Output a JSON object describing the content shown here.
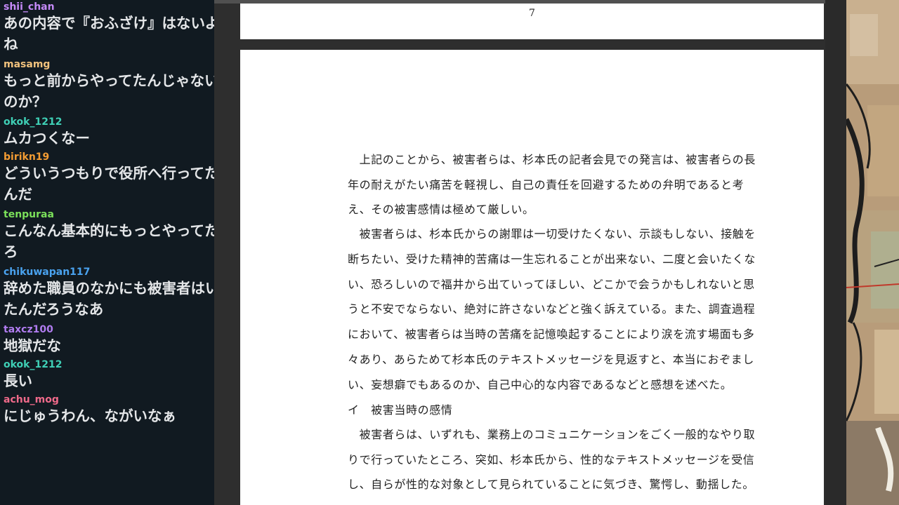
{
  "chat": {
    "messages": [
      {
        "user": "shii_chan",
        "color": "#c58af9",
        "text": "あの内容で『おふざけ』はないよね"
      },
      {
        "user": "masamg",
        "color": "#f1c27d",
        "text": "もっと前からやってたんじゃないのか？"
      },
      {
        "user": "okok_1212",
        "color": "#3fd0b6",
        "text": "ムカつくなー"
      },
      {
        "user": "birikn19",
        "color": "#f39c33",
        "text": "どういうつもりで役所へ行ってたんだ"
      },
      {
        "user": "tenpuraa",
        "color": "#7be05a",
        "text": "こんなん基本的にもっとやってたろ"
      },
      {
        "user": "chikuwapan117",
        "color": "#4aa3f0",
        "text": "辞めた職員のなかにも被害者はいたんだろうなあ"
      },
      {
        "user": "taxcz100",
        "color": "#b07cf0",
        "text": "地獄だな"
      },
      {
        "user": "okok_1212",
        "color": "#3fd0b6",
        "text": "長い"
      },
      {
        "user": "achu_mog",
        "color": "#f06a8a",
        "text": "にじゅうわん、ながいなぁ"
      }
    ]
  },
  "document": {
    "prev_page_number": "7",
    "lines": [
      "　上記のことから、被害者らは、杉本氏の記者会見での発言は、被害者らの長",
      "年の耐えがたい痛苦を軽視し、自己の責任を回避するための弁明であると考",
      "え、その被害感情は極めて厳しい。",
      "　被害者らは、杉本氏からの謝罪は一切受けたくない、示談もしない、接触を",
      "断ちたい、受けた精神的苦痛は一生忘れることが出来ない、二度と会いたくな",
      "い、恐ろしいので福井から出ていってほしい、どこかで会うかもしれないと思",
      "うと不安でならない、絶対に許さないなどと強く訴えている。また、調査過程",
      "において、被害者らは当時の苦痛を記憶喚起することにより涙を流す場面も多",
      "々あり、あらためて杉本氏のテキストメッセージを見返すと、本当におぞまし",
      "い、妄想癖でもあるのか、自己中心的な内容であるなどと感想を述べた。",
      "イ　被害当時の感情",
      "　被害者らは、いずれも、業務上のコミュニケーションをごく一般的なやり取",
      "りで行っていたところ、突如、杉本氏から、性的なテキストメッセージを受信",
      "し、自らが性的な対象として見られていることに気づき、驚愕し、動揺した。"
    ]
  }
}
